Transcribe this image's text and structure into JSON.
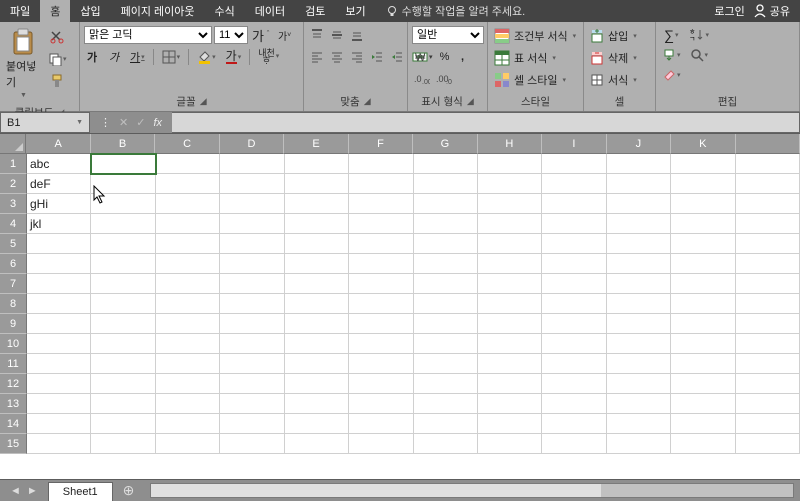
{
  "menu": {
    "tabs": [
      "파일",
      "홈",
      "삽입",
      "페이지 레이아웃",
      "수식",
      "데이터",
      "검토",
      "보기"
    ],
    "active_index": 1,
    "tellme": "수행할 작업을 알려 주세요.",
    "login": "로그인",
    "share": "공유"
  },
  "ribbon": {
    "clipboard": {
      "paste": "붙여넣기",
      "label": "클립보드"
    },
    "font": {
      "name": "맑은 고딕",
      "size": "11",
      "bold": "가",
      "italic": "가",
      "underline": "가",
      "hanja": "내천\nᄒᆞ",
      "grow": "가",
      "shrink": "가",
      "label": "글꼴"
    },
    "align": {
      "wrap": "",
      "merge": "",
      "label": "맞춤"
    },
    "number": {
      "format": "일반",
      "label": "표시 형식"
    },
    "styles": {
      "cond": "조건부 서식",
      "table": "표 서식",
      "cell": "셀 스타일",
      "label": "스타일"
    },
    "cells": {
      "insert": "삽입",
      "delete": "삭제",
      "format": "서식",
      "label": "셀"
    },
    "editing": {
      "label": "편집"
    }
  },
  "namebox": "B1",
  "columns": [
    "A",
    "B",
    "C",
    "D",
    "E",
    "F",
    "G",
    "H",
    "I",
    "J",
    "K",
    ""
  ],
  "rows": [
    1,
    2,
    3,
    4,
    5,
    6,
    7,
    8,
    9,
    10,
    11,
    12,
    13,
    14,
    15
  ],
  "data": {
    "A1": "abc",
    "A2": "deF",
    "A3": "gHi",
    "A4": "jkl"
  },
  "active_cell": "B1",
  "sheet": {
    "name": "Sheet1"
  }
}
